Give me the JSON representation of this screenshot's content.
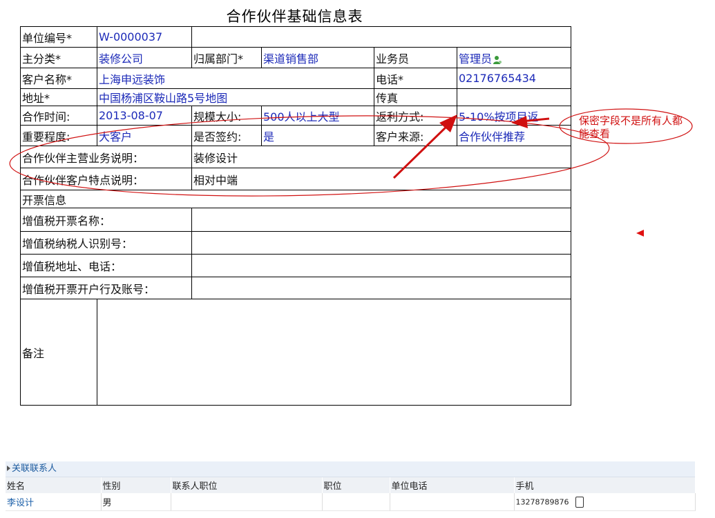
{
  "form": {
    "title": "合作伙伴基础信息表",
    "unit_no_label": "单位编号*",
    "unit_no_value": "W-0000037",
    "category_label": "主分类*",
    "category_value": "装修公司",
    "dept_label": "归属部门*",
    "dept_value": "渠道销售部",
    "sales_label": "业务员",
    "sales_value": "管理员",
    "customer_label": "客户名称*",
    "customer_value": "上海申远装饰",
    "phone_label": "电话*",
    "phone_value": "02176765434",
    "address_label": "地址*",
    "address_value": "中国杨浦区鞍山路5号",
    "map_link": "地图",
    "fax_label": "传真",
    "fax_value": "",
    "coop_time_label": "合作时间:",
    "coop_time_value": "2013-08-07",
    "scale_label": "规模大小:",
    "scale_value": "500人以上大型",
    "rebate_label": "返利方式:",
    "rebate_value": "5-10%按项目返",
    "importance_label": "重要程度:",
    "importance_value": "大客户",
    "signed_label": "是否签约:",
    "signed_value": "是",
    "source_label": "客户来源:",
    "source_value": "合作伙伴推荐",
    "main_business_label": "合作伙伴主营业务说明：",
    "main_business_value": "装修设计",
    "customer_feature_label": "合作伙伴客户特点说明：",
    "customer_feature_value": "相对中端",
    "invoice_info_label": "开票信息",
    "vat_name_label": "增值税开票名称：",
    "vat_taxpayer_label": "增值税纳税人识别号：",
    "vat_address_label": "增值税地址、电话：",
    "vat_bank_label": "增值税开票开户行及账号：",
    "remark_label": "备注"
  },
  "annotation": {
    "note": "保密字段不是所有人都能查看",
    "color": "#d01010"
  },
  "contacts": {
    "section_title": "关联联系人",
    "headers": [
      "姓名",
      "性别",
      "联系人职位",
      "职位",
      "单位电话",
      "手机"
    ],
    "rows": [
      {
        "name": "李设计",
        "gender": "男",
        "contact_position": "",
        "position": "",
        "unit_phone": "",
        "mobile": "13278789876"
      }
    ]
  },
  "icons": [
    "person-icon",
    "phone-icon",
    "expand-triangle-icon",
    "marker-arrow-icon"
  ]
}
